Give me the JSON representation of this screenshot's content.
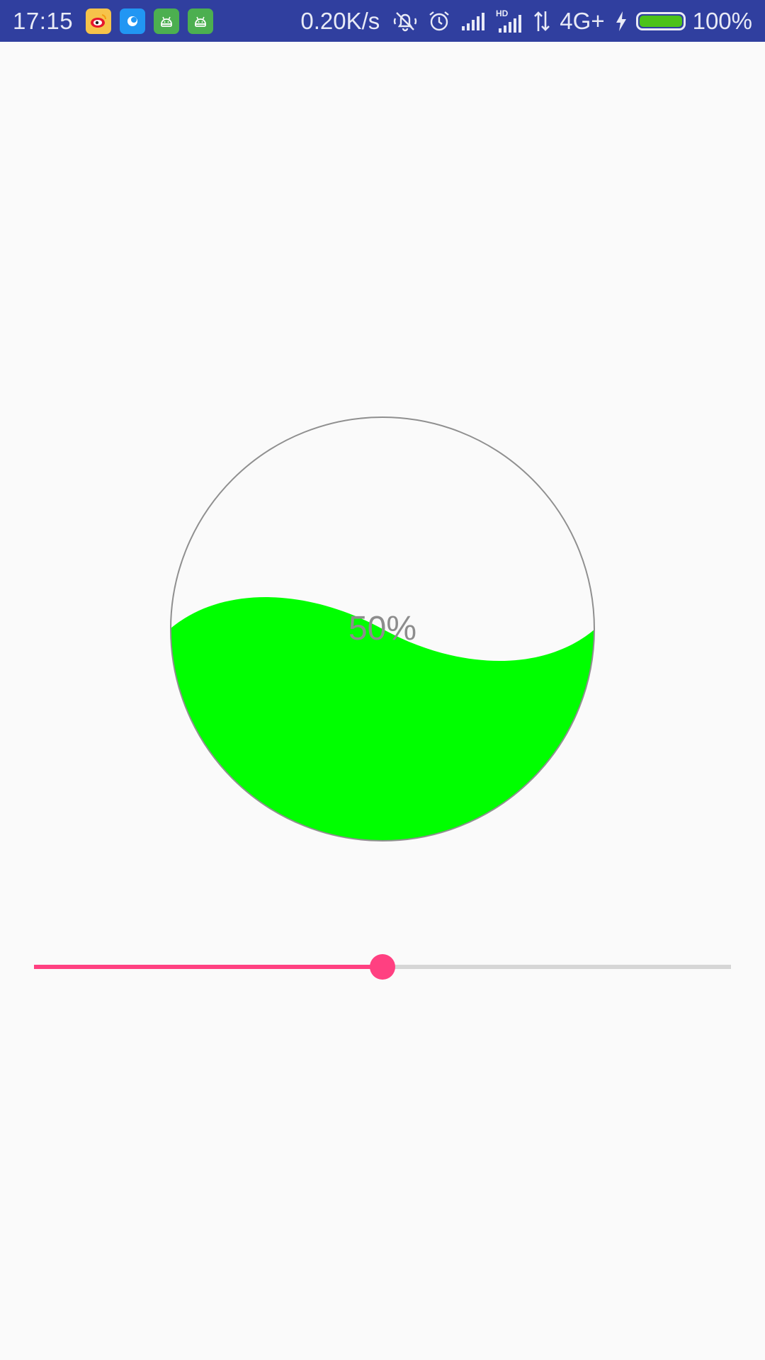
{
  "status_bar": {
    "time": "17:15",
    "net_speed": "0.20K/s",
    "network_type": "4G+",
    "battery_level": "100%",
    "battery_fraction": 1.0,
    "app_icons": [
      "weibo-icon",
      "blue-app-icon",
      "android-app-icon",
      "android-app-icon"
    ],
    "system_icons": [
      "mute-bell-icon",
      "alarm-icon",
      "signal-icon",
      "hd-signal-icon",
      "data-arrows-icon",
      "charging-icon",
      "battery-icon"
    ],
    "colors": {
      "background": "#303f9f",
      "battery_fill": "#4cc21a"
    }
  },
  "wave_gauge": {
    "progress_text": "50%",
    "progress": 0.5,
    "colors": {
      "water": "#00ff00",
      "outline": "#8f8f8f",
      "text": "#8d8d8d"
    }
  },
  "slider": {
    "progress": 0.5,
    "colors": {
      "active": "#ff4081",
      "inactive": "#d6d6d6"
    }
  }
}
